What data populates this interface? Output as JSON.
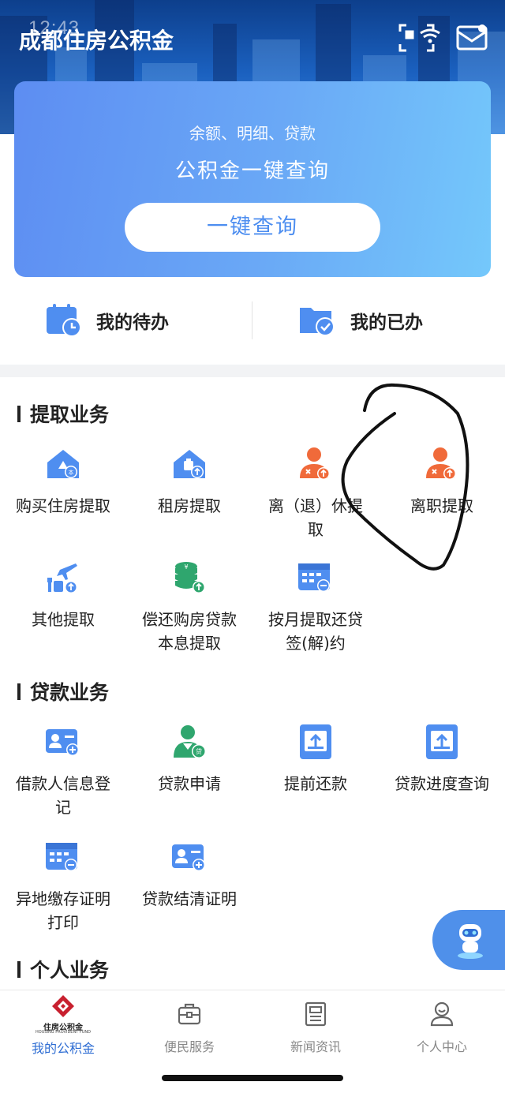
{
  "status_bar": {
    "time": "12:43"
  },
  "header": {
    "title": "成都住房公积金",
    "icons": [
      "scan-icon",
      "message-icon"
    ]
  },
  "query_card": {
    "subtitle": "余额、明细、贷款",
    "title": "公积金一键查询",
    "button_label": "一键查询"
  },
  "todo": {
    "pending_label": "我的待办",
    "done_label": "我的已办"
  },
  "sections": {
    "withdraw": {
      "title": "提取业务",
      "items": [
        {
          "label": "购买住房提取",
          "icon": "house-buy-icon"
        },
        {
          "label": "租房提取",
          "icon": "house-rent-icon"
        },
        {
          "label": "离（退）休提取",
          "icon": "person-retire-icon"
        },
        {
          "label": "离职提取",
          "icon": "person-resign-icon"
        },
        {
          "label": "其他提取",
          "icon": "travel-icon"
        },
        {
          "label": "偿还购房贷款本息提取",
          "icon": "coin-stack-icon"
        },
        {
          "label": "按月提取还贷签(解)约",
          "icon": "calendar-icon"
        }
      ]
    },
    "loan": {
      "title": "贷款业务",
      "items": [
        {
          "label": "借款人信息登记",
          "icon": "id-card-add-icon"
        },
        {
          "label": "贷款申请",
          "icon": "loan-person-icon"
        },
        {
          "label": "提前还款",
          "icon": "upload-tray-icon"
        },
        {
          "label": "贷款进度查询",
          "icon": "upload-tray-icon"
        },
        {
          "label": "异地缴存证明打印",
          "icon": "calendar-icon"
        },
        {
          "label": "贷款结清证明",
          "icon": "id-card-add-icon"
        }
      ]
    },
    "personal": {
      "title": "个人业务"
    }
  },
  "tabbar": {
    "items": [
      {
        "label": "我的公积金",
        "icon": "fund-logo-icon",
        "logo_text": "住房公积金",
        "logo_subtext": "HOUSING PROVIDENT FUND",
        "active": true
      },
      {
        "label": "便民服务",
        "icon": "briefcase-icon"
      },
      {
        "label": "新闻资讯",
        "icon": "news-icon"
      },
      {
        "label": "个人中心",
        "icon": "user-icon"
      }
    ]
  },
  "colors": {
    "primary": "#4f8ef0",
    "accent_orange": "#f06a3a",
    "green": "#2fa66e",
    "active_tab": "#2e6dd3"
  }
}
